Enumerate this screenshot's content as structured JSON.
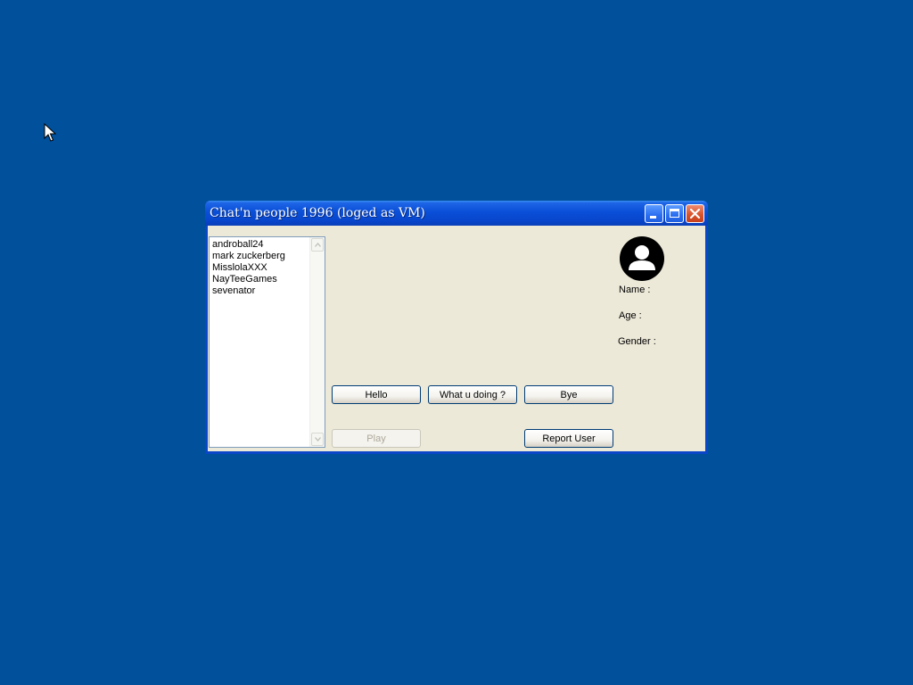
{
  "window": {
    "title": "Chat'n people 1996 (loged as VM)"
  },
  "icons": {
    "cursor": "arrow-cursor-icon",
    "minimize": "minimize-icon",
    "maximize": "maximize-icon",
    "close": "close-icon",
    "avatar": "user-avatar-icon",
    "scroll_up": "scroll-up-icon",
    "scroll_down": "scroll-down-icon"
  },
  "colors": {
    "desktop": "#00509c",
    "titlebar": "#0a4fd8",
    "close_button": "#d8542c",
    "window_face": "#ece9d8"
  },
  "users": [
    "androball24",
    "mark zuckerberg",
    "MisslolaXXX",
    "NayTeeGames",
    "sevenator"
  ],
  "buttons": {
    "hello": "Hello",
    "what": "What u doing ?",
    "bye": "Bye",
    "play": "Play",
    "report": "Report User"
  },
  "profile": {
    "name_label": "Name :",
    "age_label": "Age :",
    "gender_label": "Gender :"
  }
}
